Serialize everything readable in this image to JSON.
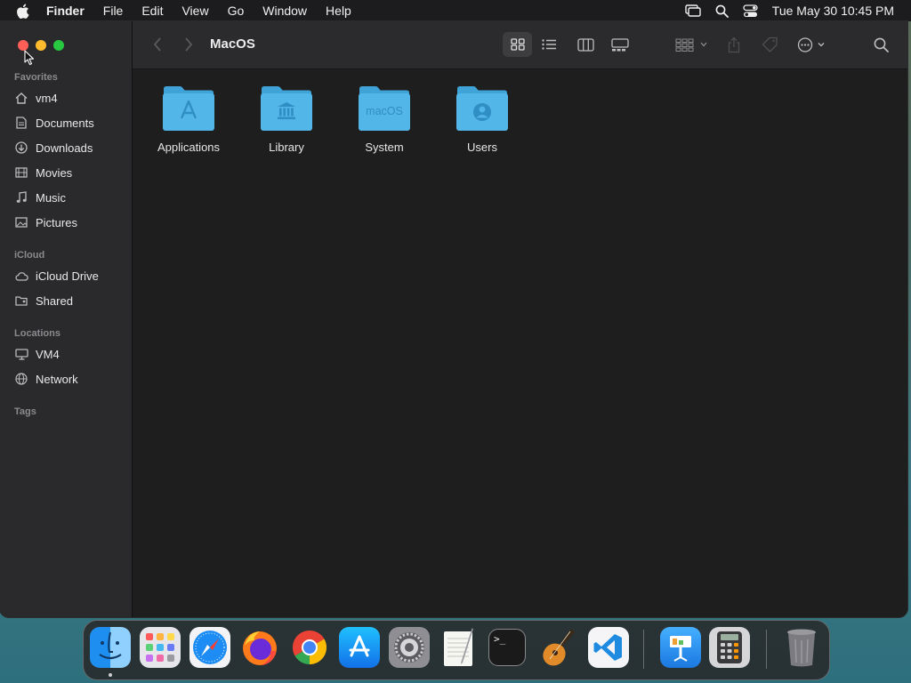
{
  "menubar": {
    "app_name": "Finder",
    "menus": [
      "File",
      "Edit",
      "View",
      "Go",
      "Window",
      "Help"
    ],
    "clock": "Tue May 30  10:45 PM",
    "status_icons": [
      "screen-mirroring-icon",
      "spotlight-search-icon",
      "control-center-icon"
    ]
  },
  "window": {
    "title": "MacOS",
    "traffic_lights": {
      "close": "#ff5f57",
      "minimize": "#febc2e",
      "zoom": "#28c840"
    }
  },
  "sidebar": {
    "sections": [
      {
        "title": "Favorites",
        "items": [
          {
            "label": "vm4",
            "icon": "home-icon"
          },
          {
            "label": "Documents",
            "icon": "document-icon"
          },
          {
            "label": "Downloads",
            "icon": "download-icon"
          },
          {
            "label": "Movies",
            "icon": "film-icon"
          },
          {
            "label": "Music",
            "icon": "music-note-icon"
          },
          {
            "label": "Pictures",
            "icon": "photo-icon"
          }
        ]
      },
      {
        "title": "iCloud",
        "items": [
          {
            "label": "iCloud Drive",
            "icon": "cloud-icon"
          },
          {
            "label": "Shared",
            "icon": "shared-folder-icon"
          }
        ]
      },
      {
        "title": "Locations",
        "items": [
          {
            "label": "VM4",
            "icon": "computer-icon"
          },
          {
            "label": "Network",
            "icon": "globe-icon"
          }
        ]
      },
      {
        "title": "Tags",
        "items": []
      }
    ]
  },
  "toolbar": {
    "icons": [
      "back-icon",
      "forward-icon",
      "icon-view-icon",
      "list-view-icon",
      "column-view-icon",
      "gallery-view-icon",
      "group-icon",
      "share-icon",
      "tag-icon",
      "more-actions-icon",
      "search-icon"
    ],
    "selected_view": "icon-view"
  },
  "files": [
    {
      "name": "Applications",
      "glyph": "A"
    },
    {
      "name": "Library",
      "glyph": ""
    },
    {
      "name": "System",
      "glyph": "macOS"
    },
    {
      "name": "Users",
      "glyph": ""
    }
  ],
  "dock": {
    "apps": [
      "Finder",
      "Launchpad",
      "Safari",
      "Firefox",
      "Google Chrome",
      "App Store",
      "System Preferences",
      "TextEdit",
      "Terminal",
      "GarageBand",
      "Visual Studio Code",
      "Keynote",
      "Calculator",
      "Trash"
    ],
    "running": [
      "Finder"
    ],
    "terminal_prompt": ">_"
  },
  "colors": {
    "folder_blue": "#52b6e8",
    "folder_tab_blue": "#3fa3d8",
    "sidebar_bg": "#2a2a2c",
    "content_bg": "#1e1e1e"
  }
}
